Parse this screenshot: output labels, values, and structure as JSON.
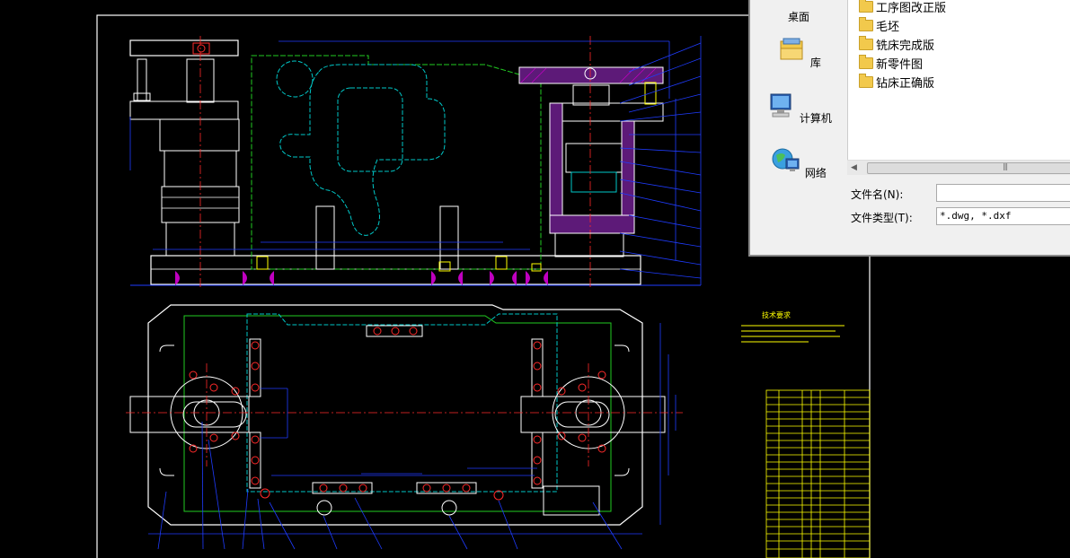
{
  "dialog": {
    "places": [
      {
        "label": "桌面",
        "icon": "desktop-icon"
      },
      {
        "label": "库",
        "icon": "library-icon"
      },
      {
        "label": "计算机",
        "icon": "computer-icon"
      },
      {
        "label": "网络",
        "icon": "network-icon"
      }
    ],
    "files": [
      {
        "name": "工序图改正版"
      },
      {
        "name": "毛坯"
      },
      {
        "name": "铣床完成版"
      },
      {
        "name": "新零件图"
      },
      {
        "name": "钻床正确版"
      }
    ],
    "filename_label": "文件名(N):",
    "filename_value": "",
    "filetype_label": "文件类型(T):",
    "filetype_value": "*.dwg, *.dxf"
  },
  "drawing": {
    "tech_title": "技术要求",
    "colors": {
      "frame": "#ffffff",
      "blue": "#1f3cff",
      "cyan": "#00c8c8",
      "green": "#22cc22",
      "red": "#ff2a2a",
      "magenta": "#c000c0",
      "yellow": "#ffff00"
    }
  }
}
